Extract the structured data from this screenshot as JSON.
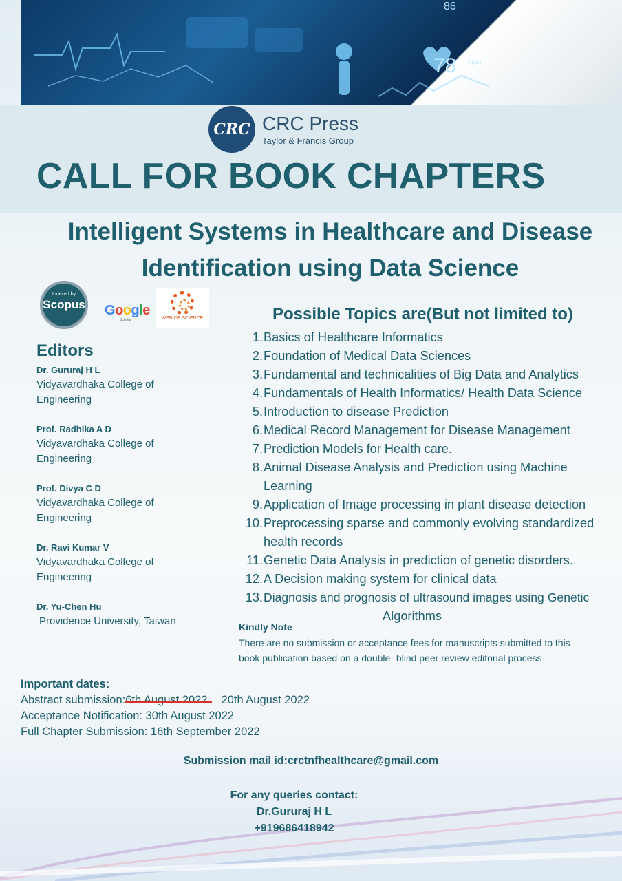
{
  "header": {
    "publisher_name": "CRC Press",
    "publisher_sub": "Taylor & Francis Group",
    "logo_text": "CRC",
    "image_readout": "78",
    "image_unit": "bpm",
    "image_top_digits": "86"
  },
  "call_title": "CALL FOR BOOK CHAPTERS",
  "book_title_line1": "Intelligent Systems in Healthcare and Disease",
  "book_title_line2": "Identification using Data Science",
  "badges": {
    "scopus_small": "Indexed by",
    "scopus_big": "Scopus",
    "google": "Google",
    "google_sub": "Scholar",
    "wos": "WEB OF SCIENCE"
  },
  "editors": {
    "title": "Editors",
    "list": [
      {
        "name": "Dr. Gururaj H L",
        "aff1": "Vidyavardhaka College of",
        "aff2": "Engineering"
      },
      {
        "name": "Prof. Radhika A D",
        "aff1": "Vidyavardhaka College of",
        "aff2": "Engineering"
      },
      {
        "name": "Prof. Divya C D",
        "aff1": "Vidyavardhaka College of",
        "aff2": "Engineering"
      },
      {
        "name": "Dr. Ravi Kumar V",
        "aff1": "Vidyavardhaka College of",
        "aff2": "Engineering"
      },
      {
        "name": "Dr. Yu-Chen Hu",
        "aff1": "Providence University, Taiwan",
        "aff2": ""
      }
    ]
  },
  "topics": {
    "title": "Possible Topics are(But not limited to)",
    "items": [
      {
        "num": "1.",
        "text": "Basics of Healthcare Informatics"
      },
      {
        "num": "2.",
        "text": "Foundation of Medical Data Sciences"
      },
      {
        "num": "3.",
        "text": "Fundamental and technicalities of Big Data and Analytics"
      },
      {
        "num": "4.",
        "text": "Fundamentals of Health Informatics/ Health Data Science"
      },
      {
        "num": "5.",
        "text": "Introduction to disease Prediction"
      },
      {
        "num": "6.",
        "text": "Medical Record Management for Disease Management"
      },
      {
        "num": "7.",
        "text": "Prediction Models for Health care."
      },
      {
        "num": "8.",
        "text": "Animal Disease Analysis and Prediction using Machine Learning"
      },
      {
        "num": "9.",
        "text": "Application of Image processing in plant disease detection"
      },
      {
        "num": "10.",
        "text": "Preprocessing sparse and commonly evolving standardized health records"
      },
      {
        "num": "11.",
        "text": "Genetic Data Analysis in prediction of genetic disorders."
      },
      {
        "num": "12.",
        "text": "A Decision making system for clinical data"
      },
      {
        "num": "13.",
        "text": "Diagnosis and prognosis of ultrasound images using Genetic",
        "cont": "Algorithms"
      }
    ]
  },
  "kindly_note": {
    "title": "Kindly Note",
    "text": "There are no submission or acceptance fees for manuscripts submitted to this book publication based on a double- blind peer review editorial process"
  },
  "dates": {
    "title": "Important dates:",
    "abstract_label": "Abstract submission:",
    "abstract_old": "6th August 2022",
    "abstract_new": "20th August 2022",
    "acceptance": "Acceptance Notification: 30th August 2022",
    "full": "Full Chapter Submission: 16th September 2022"
  },
  "submission": "Submission mail id:crctnfhealthcare@gmail.com",
  "contact": {
    "line1": "For any queries contact:",
    "line2": "Dr.Gururaj H L",
    "line3": "+919686418942"
  }
}
